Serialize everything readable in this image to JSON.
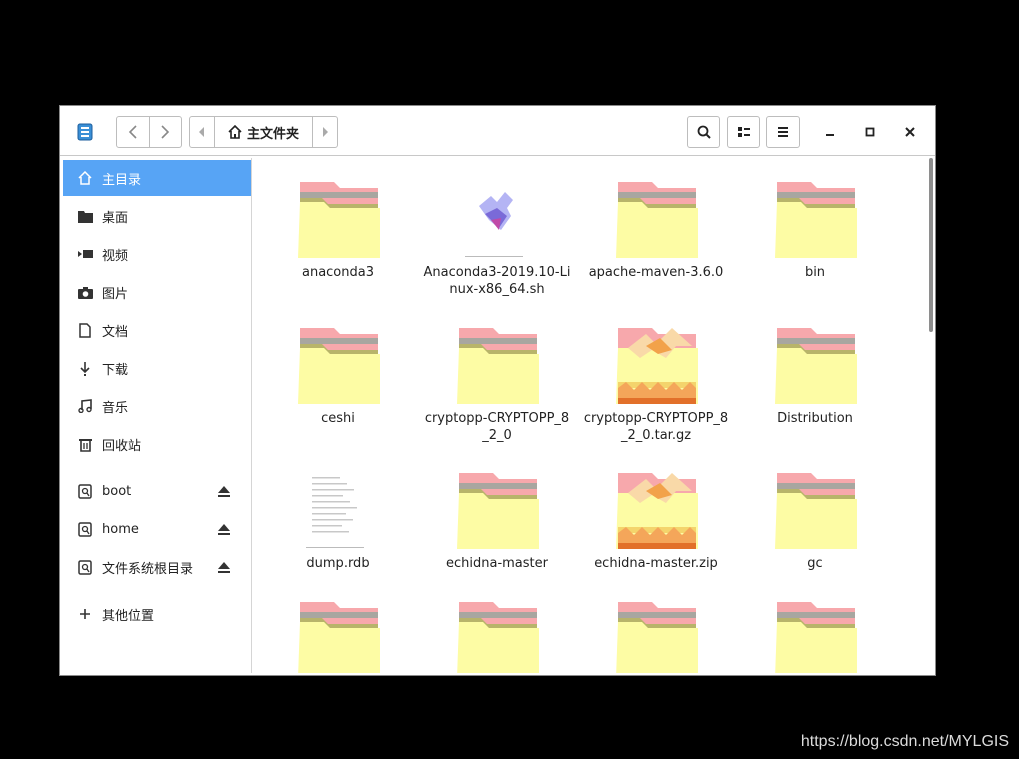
{
  "header": {
    "path_label": "主文件夹"
  },
  "sidebar": {
    "items": [
      {
        "label": "主目录",
        "icon": "home-icon"
      },
      {
        "label": "桌面",
        "icon": "desktop-folder-icon"
      },
      {
        "label": "视频",
        "icon": "video-icon"
      },
      {
        "label": "图片",
        "icon": "camera-icon"
      },
      {
        "label": "文档",
        "icon": "document-icon"
      },
      {
        "label": "下载",
        "icon": "download-icon"
      },
      {
        "label": "音乐",
        "icon": "music-icon"
      },
      {
        "label": "回收站",
        "icon": "trash-icon"
      }
    ],
    "devices": [
      {
        "label": "boot",
        "icon": "drive-icon"
      },
      {
        "label": "home",
        "icon": "drive-icon"
      },
      {
        "label": "文件系统根目录",
        "icon": "drive-icon"
      }
    ],
    "other_label": "其他位置"
  },
  "files": [
    {
      "name": "anaconda3",
      "type": "folder"
    },
    {
      "name": "Anaconda3-2019.10-Linux-x86_64.sh",
      "type": "script"
    },
    {
      "name": "apache-maven-3.6.0",
      "type": "folder"
    },
    {
      "name": "bin",
      "type": "folder"
    },
    {
      "name": "ceshi",
      "type": "folder"
    },
    {
      "name": "cryptopp-CRYPTOPP_8_2_0",
      "type": "folder"
    },
    {
      "name": "cryptopp-CRYPTOPP_8_2_0.tar.gz",
      "type": "archive"
    },
    {
      "name": "Distribution",
      "type": "folder"
    },
    {
      "name": "dump.rdb",
      "type": "text"
    },
    {
      "name": "echidna-master",
      "type": "folder"
    },
    {
      "name": "echidna-master.zip",
      "type": "archive"
    },
    {
      "name": "gc",
      "type": "folder"
    },
    {
      "name": "",
      "type": "folder"
    },
    {
      "name": "",
      "type": "folder"
    },
    {
      "name": "",
      "type": "folder"
    },
    {
      "name": "",
      "type": "folder"
    }
  ],
  "watermark": "https://blog.csdn.net/MYLGIS",
  "colors": {
    "accent": "#57a4f5",
    "folder_body": "#fdfca4",
    "folder_tab": "#f7a8ac",
    "folder_stripe": "#a8a6a0",
    "folder_olive": "#b8b46a"
  }
}
